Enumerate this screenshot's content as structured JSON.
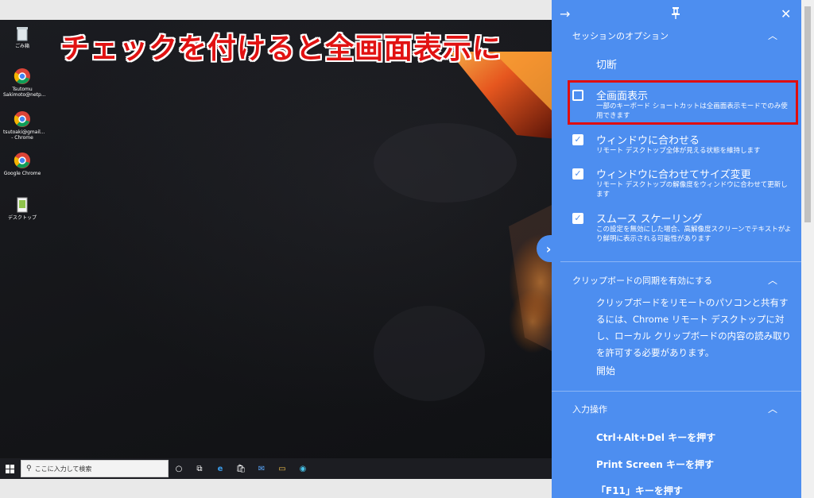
{
  "annotation": {
    "text": "チェックを付けると全画面表示に",
    "color": "#e11212"
  },
  "desktop": {
    "icons": [
      {
        "name": "recycle-bin",
        "label": "ごみ箱"
      },
      {
        "name": "chrome-profile-1",
        "label": "Tsutomu Sakimoto@netp..."
      },
      {
        "name": "chrome-profile-2",
        "label": "tsutoaki@gmail... - Chrome"
      },
      {
        "name": "google-chrome",
        "label": "Google Chrome"
      },
      {
        "name": "desktop-shortcut",
        "label": "デスクトップ"
      }
    ],
    "taskbar": {
      "search_placeholder": "ここに入力して検索"
    }
  },
  "panel": {
    "accent": "#4d8ef0",
    "session_options": {
      "header": "セッションのオプション",
      "disconnect": "切断",
      "options": [
        {
          "title": "全画面表示",
          "desc": "一部のキーボード ショートカットは全画面表示モードでのみ使用できます",
          "checked": false
        },
        {
          "title": "ウィンドウに合わせる",
          "desc": "リモート デスクトップ全体が見える状態を維持します",
          "checked": true
        },
        {
          "title": "ウィンドウに合わせてサイズ変更",
          "desc": "リモート デスクトップの解像度をウィンドウに合わせて更新します",
          "checked": true
        },
        {
          "title": "スムース スケーリング",
          "desc": "この設定を無効にした場合、高解像度スクリーンでテキストがより鮮明に表示される可能性があります",
          "checked": true
        }
      ]
    },
    "clipboard": {
      "header": "クリップボードの同期を有効にする",
      "body": "クリップボードをリモートのパソコンと共有するには、Chrome リモート デスクトップに対し、ローカル クリップボードの内容の読み取りを許可する必要があります。",
      "start": "開始"
    },
    "input": {
      "header": "入力操作",
      "actions": [
        "Ctrl+Alt+Del キーを押す",
        "Print Screen キーを押す",
        "「F11」キーを押す"
      ]
    }
  }
}
